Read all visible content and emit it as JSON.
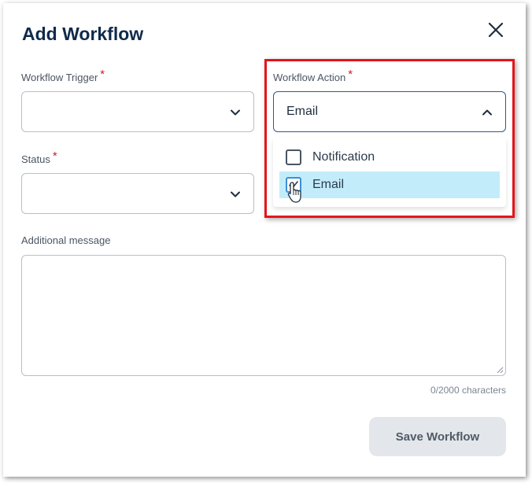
{
  "dialog": {
    "title": "Add Workflow",
    "close_icon": "close-icon"
  },
  "fields": {
    "trigger": {
      "label": "Workflow Trigger",
      "required_mark": "*",
      "value": ""
    },
    "status": {
      "label": "Status",
      "required_mark": "*",
      "value": ""
    },
    "action": {
      "label": "Workflow Action",
      "required_mark": "*",
      "value": "Email",
      "expanded": true,
      "options": [
        {
          "label": "Notification",
          "checked": false
        },
        {
          "label": "Email",
          "checked": true
        }
      ]
    },
    "message": {
      "label": "Additional message",
      "value": "",
      "counter": "0/2000 characters"
    }
  },
  "actions": {
    "save_label": "Save Workflow"
  },
  "colors": {
    "title": "#0f2a4a",
    "required": "#c0262c",
    "highlight_border": "#e3151a",
    "active_option_bg": "#c3ecfb",
    "button_bg": "#e3e6ea"
  }
}
